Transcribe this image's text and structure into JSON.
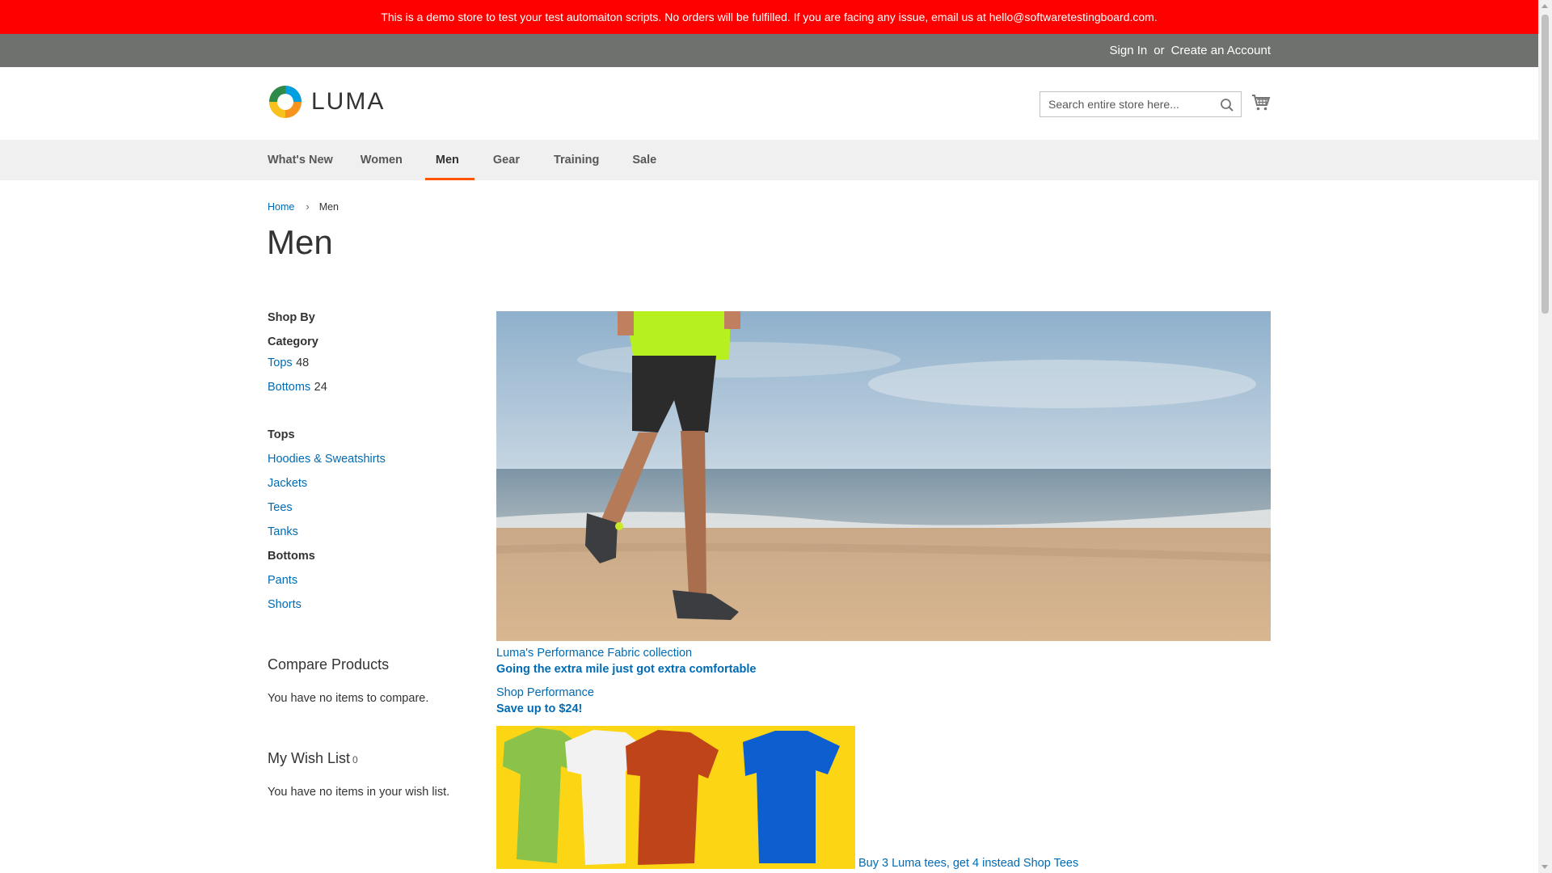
{
  "banner": {
    "text": "This is a demo store to test your test automaiton scripts. No orders will be fulfilled. If you are facing any issue, email us at hello@softwaretestingboard.com."
  },
  "header": {
    "sign_in": "Sign In",
    "or": "or",
    "create_account": "Create an Account",
    "logo_text": "LUMA",
    "search_placeholder": "Search entire store here...",
    "search_icon": "search-icon",
    "cart_icon": "cart-icon"
  },
  "nav": {
    "items": [
      {
        "label": "What's New"
      },
      {
        "label": "Women"
      },
      {
        "label": "Men",
        "active": true
      },
      {
        "label": "Gear"
      },
      {
        "label": "Training"
      },
      {
        "label": "Sale"
      }
    ],
    "active_color": "#ff5501"
  },
  "breadcrumb": {
    "home": "Home",
    "current": "Men"
  },
  "page_title": "Men",
  "sidebar": {
    "shop_by": "Shop By",
    "category_title": "Category",
    "categories": [
      {
        "label": "Tops",
        "count": "48"
      },
      {
        "label": "Bottoms",
        "count": "24"
      }
    ],
    "tops_title": "Tops",
    "tops_links": [
      "Hoodies & Sweatshirts",
      "Jackets",
      "Tees",
      "Tanks"
    ],
    "bottoms_title": "Bottoms",
    "bottoms_links": [
      "Pants",
      "Shorts"
    ],
    "compare_title": "Compare Products",
    "compare_text": "You have no items to compare.",
    "wishlist_title": "My Wish List",
    "wishlist_count": "0",
    "wishlist_text": "You have no items in your wish list."
  },
  "main": {
    "promo1_link": "Luma's Performance Fabric collection",
    "promo1_strong": "Going the extra mile just got extra comfortable",
    "promo2_link": "Shop Performance",
    "promo2_strong": "Save up to $24!",
    "tees_caption": "Buy 3 Luma tees, get 4 instead Shop Tees"
  },
  "colors": {
    "banner_bg": "#ff0000",
    "topbar_bg": "#6e716e",
    "link": "#006bb4",
    "nav_bg": "#f0f0f0"
  }
}
